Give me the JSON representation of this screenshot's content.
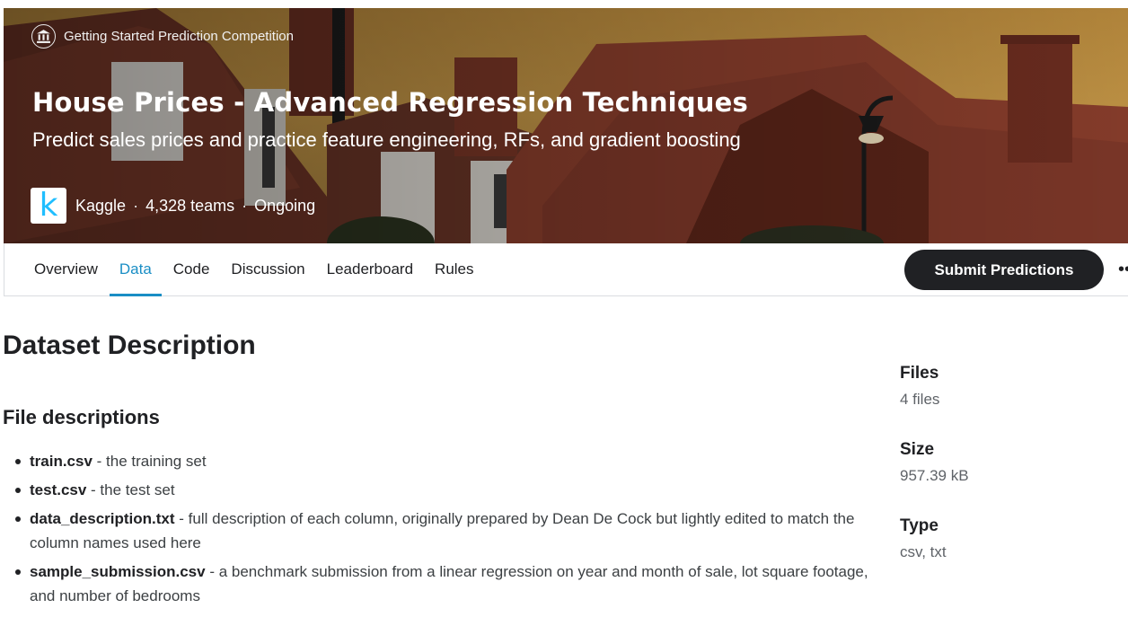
{
  "header": {
    "competition_type": "Getting Started Prediction Competition",
    "competition_icon": "institution-icon",
    "title": "House Prices - Advanced Regression Techniques",
    "subtitle": "Predict sales prices and practice feature engineering, RFs, and gradient boosting",
    "host_logo_letter": "k",
    "host": "Kaggle",
    "separator": "·",
    "teams": "4,328 teams",
    "status": "Ongoing"
  },
  "tabs": [
    {
      "label": "Overview",
      "active": false
    },
    {
      "label": "Data",
      "active": true
    },
    {
      "label": "Code",
      "active": false
    },
    {
      "label": "Discussion",
      "active": false
    },
    {
      "label": "Leaderboard",
      "active": false
    },
    {
      "label": "Rules",
      "active": false
    }
  ],
  "actions": {
    "submit_label": "Submit Predictions",
    "more_icon": "more-horizontal-icon",
    "more_glyph": "•••"
  },
  "content": {
    "heading": "Dataset Description",
    "section_heading": "File descriptions",
    "files": [
      {
        "name": "train.csv",
        "description": " - the training set"
      },
      {
        "name": "test.csv",
        "description": " - the test set"
      },
      {
        "name": "data_description.txt",
        "description": " - full description of each column, originally prepared by Dean De Cock but lightly edited to match the column names used here"
      },
      {
        "name": "sample_submission.csv",
        "description": " - a benchmark submission from a linear regression on year and month of sale, lot square footage, and number of bedrooms"
      }
    ]
  },
  "sidebar": {
    "files_label": "Files",
    "files_value": "4 files",
    "size_label": "Size",
    "size_value": "957.39 kB",
    "type_label": "Type",
    "type_value": "csv, txt"
  },
  "colors": {
    "accent": "#1a8ec5",
    "button_bg": "#202124",
    "kaggle_blue": "#20beff"
  }
}
